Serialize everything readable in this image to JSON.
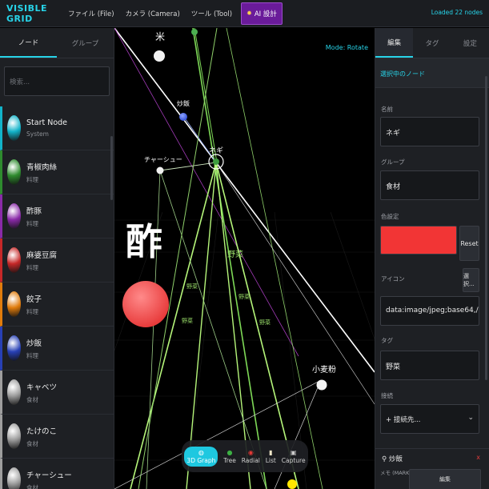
{
  "app": {
    "brand": "VISIBLE GRID",
    "loaded_status": "Loaded 22 nodes",
    "menu": [
      {
        "label": "ファイル (File)"
      },
      {
        "label": "カメラ (Camera)"
      },
      {
        "label": "ツール (Tool)"
      }
    ],
    "ai_button": "AI 設計"
  },
  "left": {
    "tabs": [
      {
        "label": "ノード"
      },
      {
        "label": "グループ"
      }
    ],
    "search_placeholder": "検索...",
    "nodes": [
      {
        "name": "Start Node",
        "group": "System",
        "color": "#12b3c9"
      },
      {
        "name": "青椒肉絲",
        "group": "料理",
        "color": "#2e8b2e"
      },
      {
        "name": "酢豚",
        "group": "料理",
        "color": "#8a2aa8"
      },
      {
        "name": "麻婆豆腐",
        "group": "料理",
        "color": "#c62828"
      },
      {
        "name": "餃子",
        "group": "料理",
        "color": "#e07c0c"
      },
      {
        "name": "炒飯",
        "group": "料理",
        "color": "#2740b5"
      },
      {
        "name": "キャベツ",
        "group": "食材",
        "color": "#9e9e9e"
      },
      {
        "name": "たけのこ",
        "group": "食材",
        "color": "#9e9e9e"
      },
      {
        "name": "チャーシュー",
        "group": "食材",
        "color": "#9e9e9e"
      }
    ]
  },
  "canvas": {
    "mode": "Mode: Rotate",
    "labels": {
      "rice": "米",
      "fried_rice": "炒飯",
      "char_siu": "チャーシュー",
      "negi": "ネギ",
      "su": "酢",
      "flour": "小麦粉",
      "yasai": "野菜"
    },
    "toolbar": [
      {
        "icon": "◍",
        "label": "3D Graph"
      },
      {
        "icon": "●",
        "label": "Tree"
      },
      {
        "icon": "◉",
        "label": "Radial"
      },
      {
        "icon": "▮",
        "label": "List"
      },
      {
        "icon": "▣",
        "label": "Capture"
      }
    ]
  },
  "right": {
    "tabs": [
      {
        "label": "編集"
      },
      {
        "label": "タグ"
      },
      {
        "label": "設定"
      }
    ],
    "selected_header": "選択中のノード",
    "fields": {
      "name_label": "名前",
      "name_value": "ネギ",
      "group_label": "グループ",
      "group_value": "食材",
      "color_label": "色設定",
      "color_value": "#f23535",
      "reset_label": "Reset",
      "icon_label": "アイコン",
      "pick_label": "選択...",
      "icon_value": "data:image/jpeg;base64,/9j/4AAQSkZJRg",
      "tag_label": "タグ",
      "tag_value": "野菜",
      "connect_label": "接続",
      "connect_value": "+ 接続先..."
    },
    "related": {
      "name": "炒飯",
      "remove": "x",
      "memo_label": "メモ (MARKDOWN)",
      "edit_label": "編集"
    }
  }
}
